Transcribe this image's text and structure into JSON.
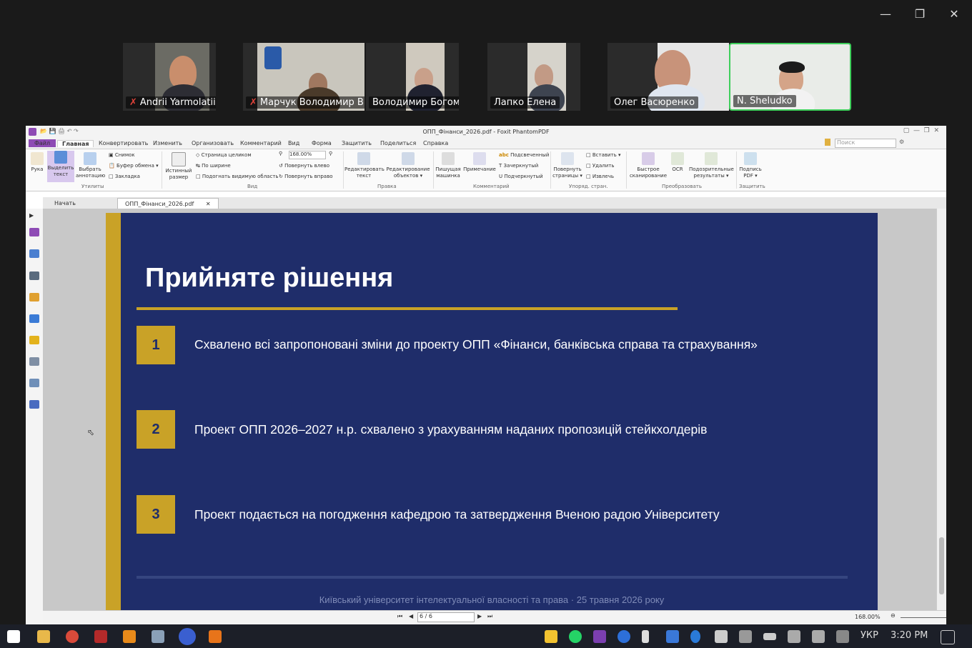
{
  "participants": [
    {
      "name": "Andrii Yarmolatii",
      "muted": true
    },
    {
      "name": "Марчук Володимир В...",
      "muted": true
    },
    {
      "name": "Володимир Богом'я",
      "muted": false
    },
    {
      "name": "Лапко Елена",
      "muted": false
    },
    {
      "name": "Олег Васюренко",
      "muted": false
    },
    {
      "name": "N. Sheludko",
      "muted": false
    }
  ],
  "app": {
    "title": "ОПП_Фінанси_2026.pdf - Foxit PhantomPDF",
    "menu": [
      "Файл",
      "Главная",
      "Конвертировать",
      "Изменить",
      "Организовать",
      "Комментарий",
      "Вид",
      "Форма",
      "Защитить",
      "Поделиться",
      "Справка"
    ],
    "search_placeholder": "Поиск",
    "ribbon": {
      "hand": "Рука",
      "select_text": "Выделить текст",
      "select_annot": "Выбрать аннотацию",
      "snapshot": "Снимок",
      "clipboard": "Буфер обмена",
      "bookmark": "Закладка",
      "actual_size": "Истинный размер",
      "fit_page": "Страница целиком",
      "fit_width": "По ширине",
      "fit_visible": "Подогнать видимую область",
      "zoom": "168.00%",
      "rotate_left": "Повернуть влево",
      "rotate_right": "Повернуть вправо",
      "edit_text": "Редактировать текст",
      "edit_object": "Редактирование объектов",
      "typewriter": "Пишущая машинка",
      "note": "Примечание",
      "highlight": "Подсвеченный",
      "strikeout": "Зачеркнутый",
      "underline": "Подчеркнутый",
      "rotate_pages": "Повернуть страницы",
      "insert": "Вставить",
      "delete": "Удалить",
      "extract": "Извлечь",
      "quick_scan": "Быстрое сканирование",
      "ocr": "OCR",
      "suspect": "Подозрительные результаты",
      "sign": "Подпись PDF",
      "groups": [
        "Утилиты",
        "Вид",
        "Правка",
        "Комментарий",
        "Упоряд. стран.",
        "Преобразовать",
        "Защитить"
      ]
    },
    "tabs": [
      "Начать",
      "ОПП_Фінанси_2026.pdf"
    ],
    "page_indicator": "6 / 6",
    "status_zoom": "168.00%"
  },
  "slide": {
    "title": "Прийняте рішення",
    "items": [
      {
        "num": "1",
        "text": "Схвалено всі запропоновані зміни до проекту ОПП «Фінанси, банківська справа та страхування»"
      },
      {
        "num": "2",
        "text": "Проект ОПП 2026–2027 н.р. схвалено з урахуванням наданих пропозицій стейкхолдерів"
      },
      {
        "num": "3",
        "text": "Проект подається на погодження кафедрою та затвердження Вченою радою Університету"
      }
    ],
    "footer": "Київський університет інтелектуальної власності та права · 25 травня 2026 року"
  },
  "taskbar": {
    "lang": "УКР",
    "time": "3:20 PM"
  }
}
